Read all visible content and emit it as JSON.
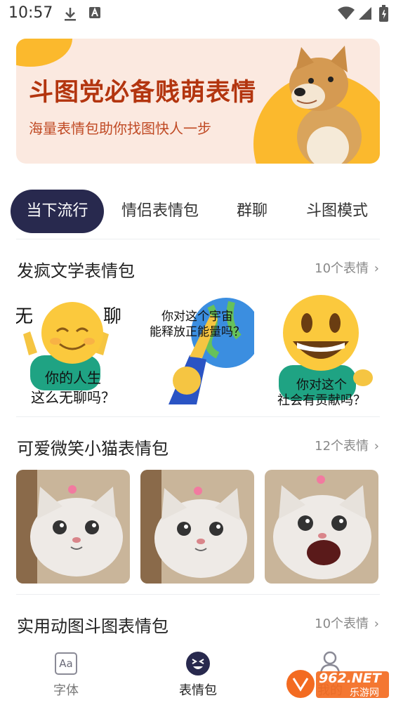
{
  "status": {
    "time": "10:57"
  },
  "banner": {
    "title": "斗图党必备贱萌表情",
    "subtitle": "海量表情包助你找图快人一步"
  },
  "tabs": [
    {
      "label": "当下流行",
      "active": true
    },
    {
      "label": "情侣表情包",
      "active": false
    },
    {
      "label": "群聊",
      "active": false
    },
    {
      "label": "斗图模式",
      "active": false
    }
  ],
  "sections": [
    {
      "title": "发疯文学表情包",
      "count": "10个表情",
      "items": [
        {
          "top": "无",
          "top2": "聊",
          "bottom": "你的人生",
          "bottom2": "这么无聊吗？"
        },
        {
          "top": "你对这个宇宙",
          "top2": "能释放正能量吗？"
        },
        {
          "bottom": "你对这个",
          "bottom2": "社会有贡献吗？"
        }
      ]
    },
    {
      "title": "可爱微笑小猫表情包",
      "count": "12个表情"
    },
    {
      "title": "实用动图斗图表情包",
      "count": "10个表情"
    }
  ],
  "nav": [
    {
      "label": "字体",
      "icon_label": "Aa",
      "active": false
    },
    {
      "label": "表情包",
      "active": true
    },
    {
      "label": "我的",
      "active": false
    }
  ],
  "watermark": {
    "text": "962.NET",
    "sub": "乐游网"
  },
  "colors": {
    "accent": "#28294e",
    "banner_bg": "#fbe9e0",
    "banner_yellow": "#fbb92d",
    "banner_title": "#b3350f"
  }
}
